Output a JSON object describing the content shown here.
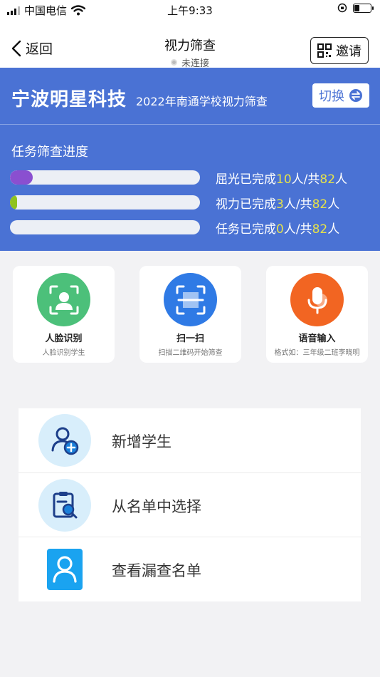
{
  "status_bar": {
    "carrier": "中国电信",
    "time": "上午9:33"
  },
  "nav": {
    "back_label": "返回",
    "title": "视力筛查",
    "connection_status": "未连接",
    "invite_label": "邀请"
  },
  "header": {
    "org_name": "宁波明星科技",
    "task_name": "2022年南通学校视力筛查",
    "switch_label": "切换",
    "progress_title": "任务筛查进度"
  },
  "progress": [
    {
      "prefix": "屈光已完成",
      "done": "10",
      "mid": "人/共",
      "total": "82",
      "suffix": "人",
      "fill_fraction": 0.12,
      "color": "#8a4fd0"
    },
    {
      "prefix": "视力已完成",
      "done": "3",
      "mid": "人/共",
      "total": "82",
      "suffix": "人",
      "fill_fraction": 0.037,
      "color": "#8fc21e"
    },
    {
      "prefix": "任务已完成",
      "done": "0",
      "mid": "人/共",
      "total": "82",
      "suffix": "人",
      "fill_fraction": 0,
      "color": "#4a72d4"
    }
  ],
  "quick_actions": [
    {
      "title": "人脸识别",
      "subtitle": "人脸识别学生",
      "icon": "face-id-icon",
      "color": "#4cc07a"
    },
    {
      "title": "扫一扫",
      "subtitle": "扫描二维码开始筛查",
      "icon": "scan-icon",
      "color": "#2f7ae5"
    },
    {
      "title": "语音输入",
      "subtitle": "格式如：三年级二班李晓明",
      "icon": "microphone-icon",
      "color": "#f26522"
    }
  ],
  "list_items": [
    {
      "label": "新增学生",
      "icon": "add-user-icon"
    },
    {
      "label": "从名单中选择",
      "icon": "clipboard-search-icon"
    },
    {
      "label": "查看漏查名单",
      "icon": "user-card-icon"
    }
  ],
  "colors": {
    "primary_blue": "#4a72d4",
    "highlight_yellow": "#e6e24a",
    "icon_blue": "#1a7fd9",
    "icon_bg": "#d8eefb"
  }
}
